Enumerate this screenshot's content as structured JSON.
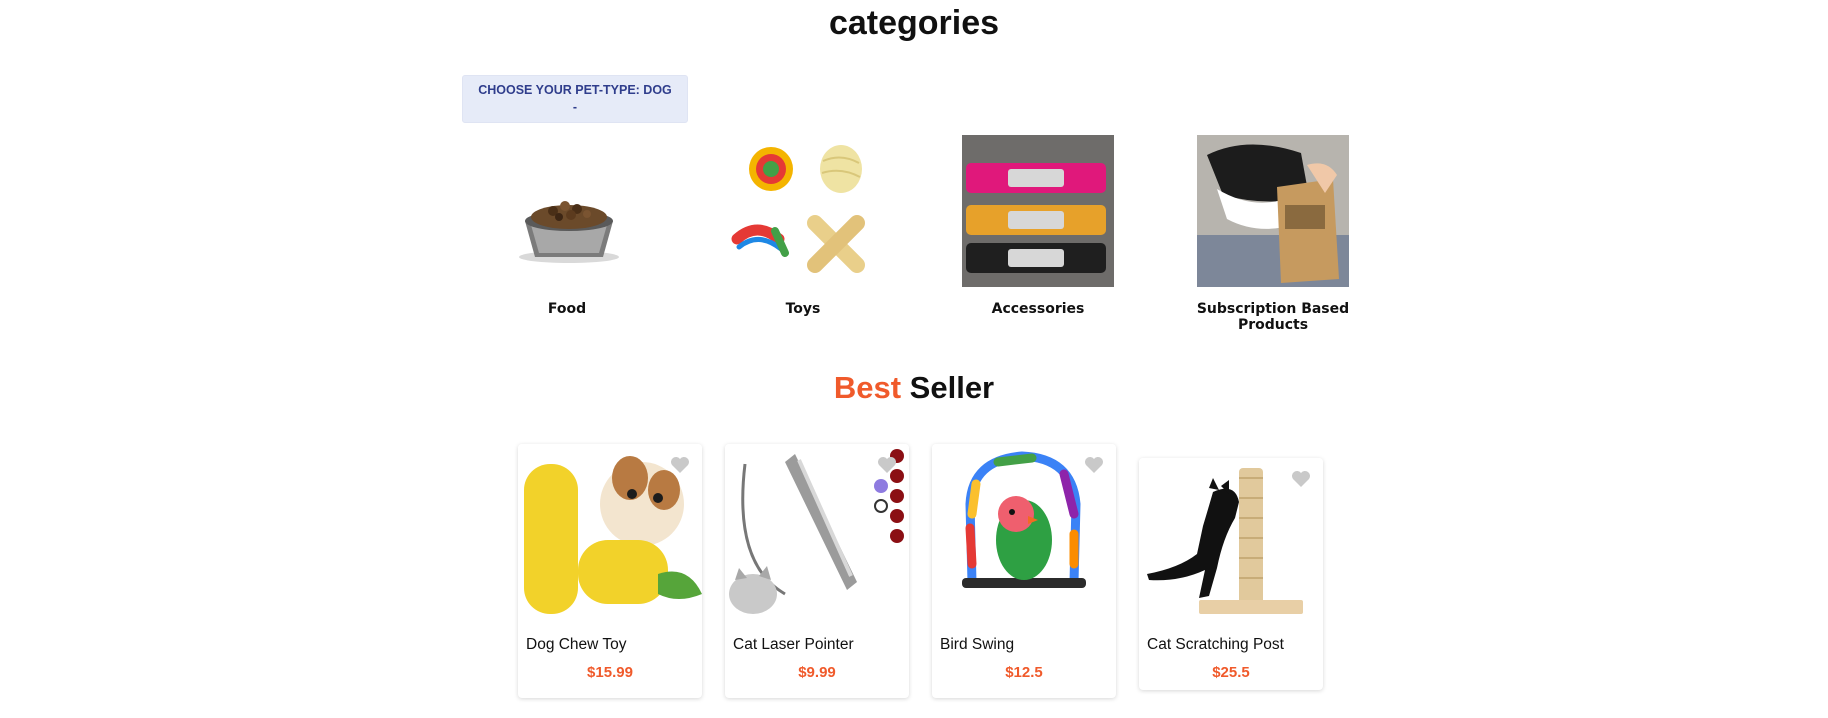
{
  "page": {
    "title": "categories"
  },
  "pet_selector": {
    "label": "CHOOSE YOUR PET-TYPE: DOG",
    "caret": "-"
  },
  "categories": [
    {
      "label": "Food",
      "icon": "food-bowl-image"
    },
    {
      "label": "Toys",
      "icon": "rope-toys-image"
    },
    {
      "label": "Accessories",
      "icon": "collars-image"
    },
    {
      "label": "Subscription Based Products",
      "icon": "subscription-box-image"
    }
  ],
  "best_seller": {
    "title_accent": "Best",
    "title_rest": " Seller",
    "products": [
      {
        "name": "Dog Chew Toy",
        "price": "$15.99",
        "icon": "corn-chew-toy-image"
      },
      {
        "name": "Cat Laser Pointer",
        "price": "$9.99",
        "icon": "laser-pointer-image"
      },
      {
        "name": "Bird Swing",
        "price": "$12.5",
        "icon": "bird-swing-image"
      },
      {
        "name": "Cat Scratching Post",
        "price": "$25.5",
        "icon": "scratching-post-image"
      }
    ]
  },
  "colors": {
    "accent": "#f05a2b",
    "dropdown_bg": "#e6ebf8",
    "dropdown_text": "#2f3d8c",
    "heart": "#c9c9c9"
  }
}
